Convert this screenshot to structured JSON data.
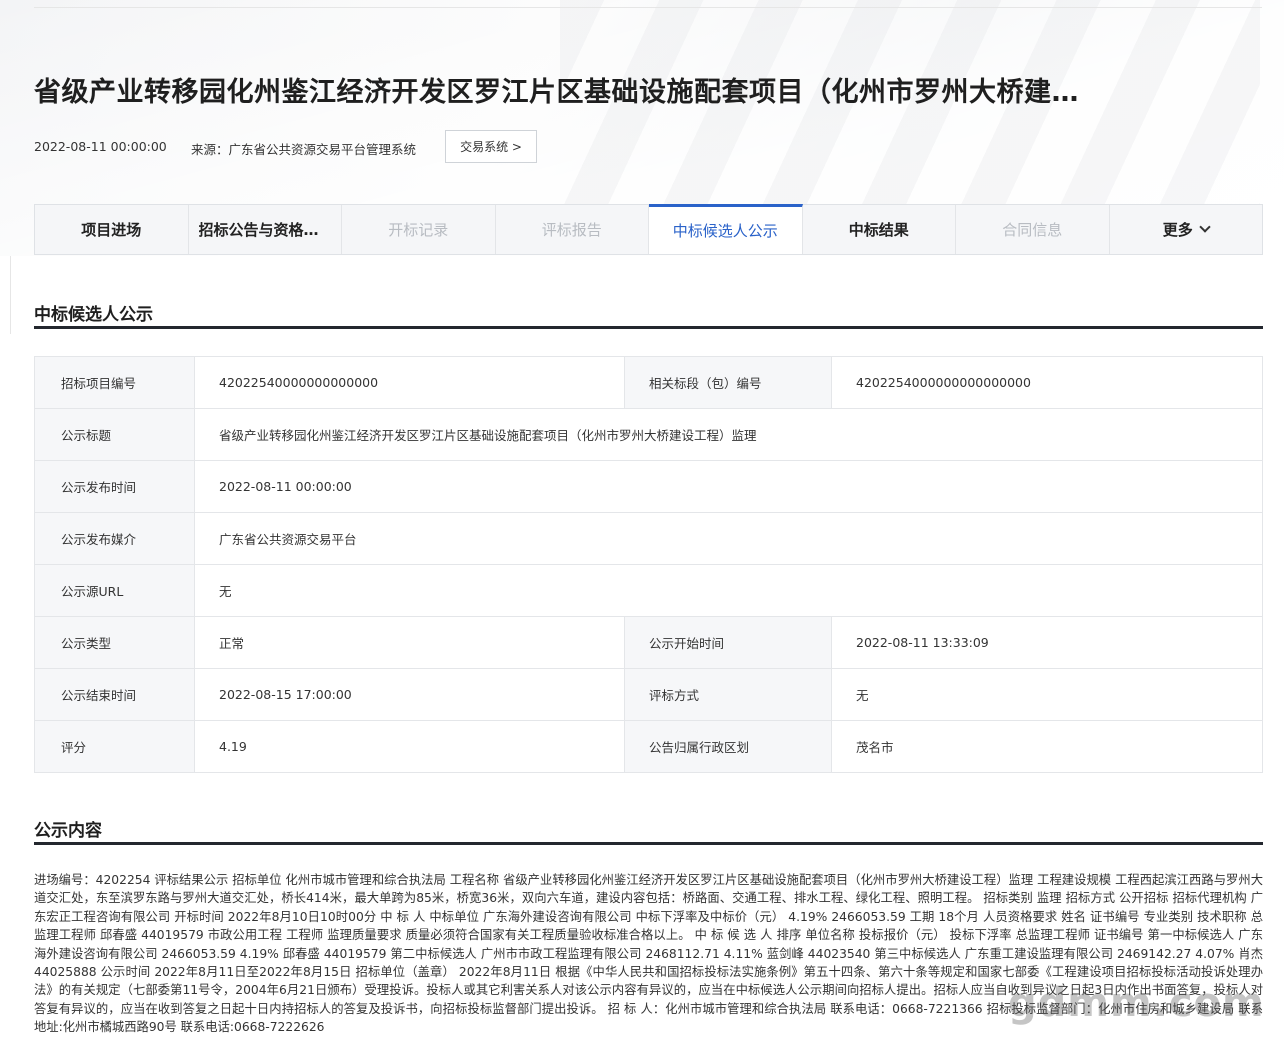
{
  "header": {
    "title": "省级产业转移园化州鉴江经济开发区罗江片区基础设施配套项目（化州市罗州大桥建设工程）监理",
    "date": "2022-08-11 00:00:00",
    "source": "来源：广东省公共资源交易平台管理系统",
    "system_button": "交易系统 >"
  },
  "tabs": [
    {
      "label": "项目进场",
      "state": "normal"
    },
    {
      "label": "招标公告与资格预审公告",
      "state": "normal"
    },
    {
      "label": "开标记录",
      "state": "disabled"
    },
    {
      "label": "评标报告",
      "state": "disabled"
    },
    {
      "label": "中标候选人公示",
      "state": "active"
    },
    {
      "label": "中标结果",
      "state": "normal"
    },
    {
      "label": "合同信息",
      "state": "disabled"
    },
    {
      "label": "更多",
      "state": "normal"
    }
  ],
  "section1": {
    "title": "中标候选人公示"
  },
  "info": {
    "project_no_label": "招标项目编号",
    "project_no": "42022540000000000000",
    "section_no_label": "相关标段（包）编号",
    "section_no": "4202254000000000000000",
    "notice_title_label": "公示标题",
    "notice_title": "省级产业转移园化州鉴江经济开发区罗江片区基础设施配套项目（化州市罗州大桥建设工程）监理",
    "publish_time_label": "公示发布时间",
    "publish_time": "2022-08-11 00:00:00",
    "media_label": "公示发布媒介",
    "media": "广东省公共资源交易平台",
    "url_label": "公示源URL",
    "url": "无",
    "type_label": "公示类型",
    "type": "正常",
    "start_label": "公示开始时间",
    "start": "2022-08-11 13:33:09",
    "end_label": "公示结束时间",
    "end": "2022-08-15 17:00:00",
    "method_label": "评标方式",
    "method": "无",
    "score_label": "评分",
    "score": "4.19",
    "region_label": "公告归属行政区划",
    "region": "茂名市"
  },
  "section2": {
    "title": "公示内容"
  },
  "content": "进场编号：4202254 评标结果公示 招标单位 化州市城市管理和综合执法局 工程名称 省级产业转移园化州鉴江经济开发区罗江片区基础设施配套项目（化州市罗州大桥建设工程）监理 工程建设规模 工程西起滨江西路与罗州大道交汇处，东至滨罗东路与罗州大道交汇处，桥长414米，最大单跨为85米，桥宽36米，双向六车道，建设内容包括：桥路面、交通工程、排水工程、绿化工程、照明工程。 招标类别 监理 招标方式 公开招标 招标代理机构 广东宏正工程咨询有限公司 开标时间 2022年8月10日10时00分 中 标 人 中标单位 广东海外建设咨询有限公司 中标下浮率及中标价（元） 4.19% 2466053.59 工期 18个月 人员资格要求 姓名 证书编号 专业类别 技术职称 总监理工程师 邱春盛 44019579 市政公用工程 工程师 监理质量要求 质量必须符合国家有关工程质量验收标准合格以上。 中 标 候 选 人 排序 单位名称 投标报价（元） 投标下浮率 总监理工程师 证书编号 第一中标候选人 广东海外建设咨询有限公司 2466053.59 4.19% 邱春盛 44019579 第二中标候选人 广州市市政工程监理有限公司 2468112.71 4.11% 蓝剑峰 44023540 第三中标候选人 广东重工建设监理有限公司 2469142.27 4.07% 肖杰 44025888 公示时间 2022年8月11日至2022年8月15日 招标单位（盖章） 2022年8月11日 根据《中华人民共和国招标投标法实施条例》第五十四条、第六十条等规定和国家七部委《工程建设项目招标投标活动投诉处理办法》的有关规定（七部委第11号令，2004年6月21日颁布）受理投诉。投标人或其它利害关系人对该公示内容有异议的，应当在中标候选人公示期间向招标人提出。招标人应当自收到异议之日起3日内作出书面答复，投标人对答复有异议的，应当在收到答复之日起十日内持招标人的答复及投诉书，向招标投标监督部门提出投诉。 招 标 人：化州市城市管理和综合执法局 联系电话：0668-7221366 招标投标监督部门：化州市住房和城乡建设局 联系地址:化州市橘城西路90号 联系电话:0668-7222626",
  "watermark": "gdmm.com"
}
